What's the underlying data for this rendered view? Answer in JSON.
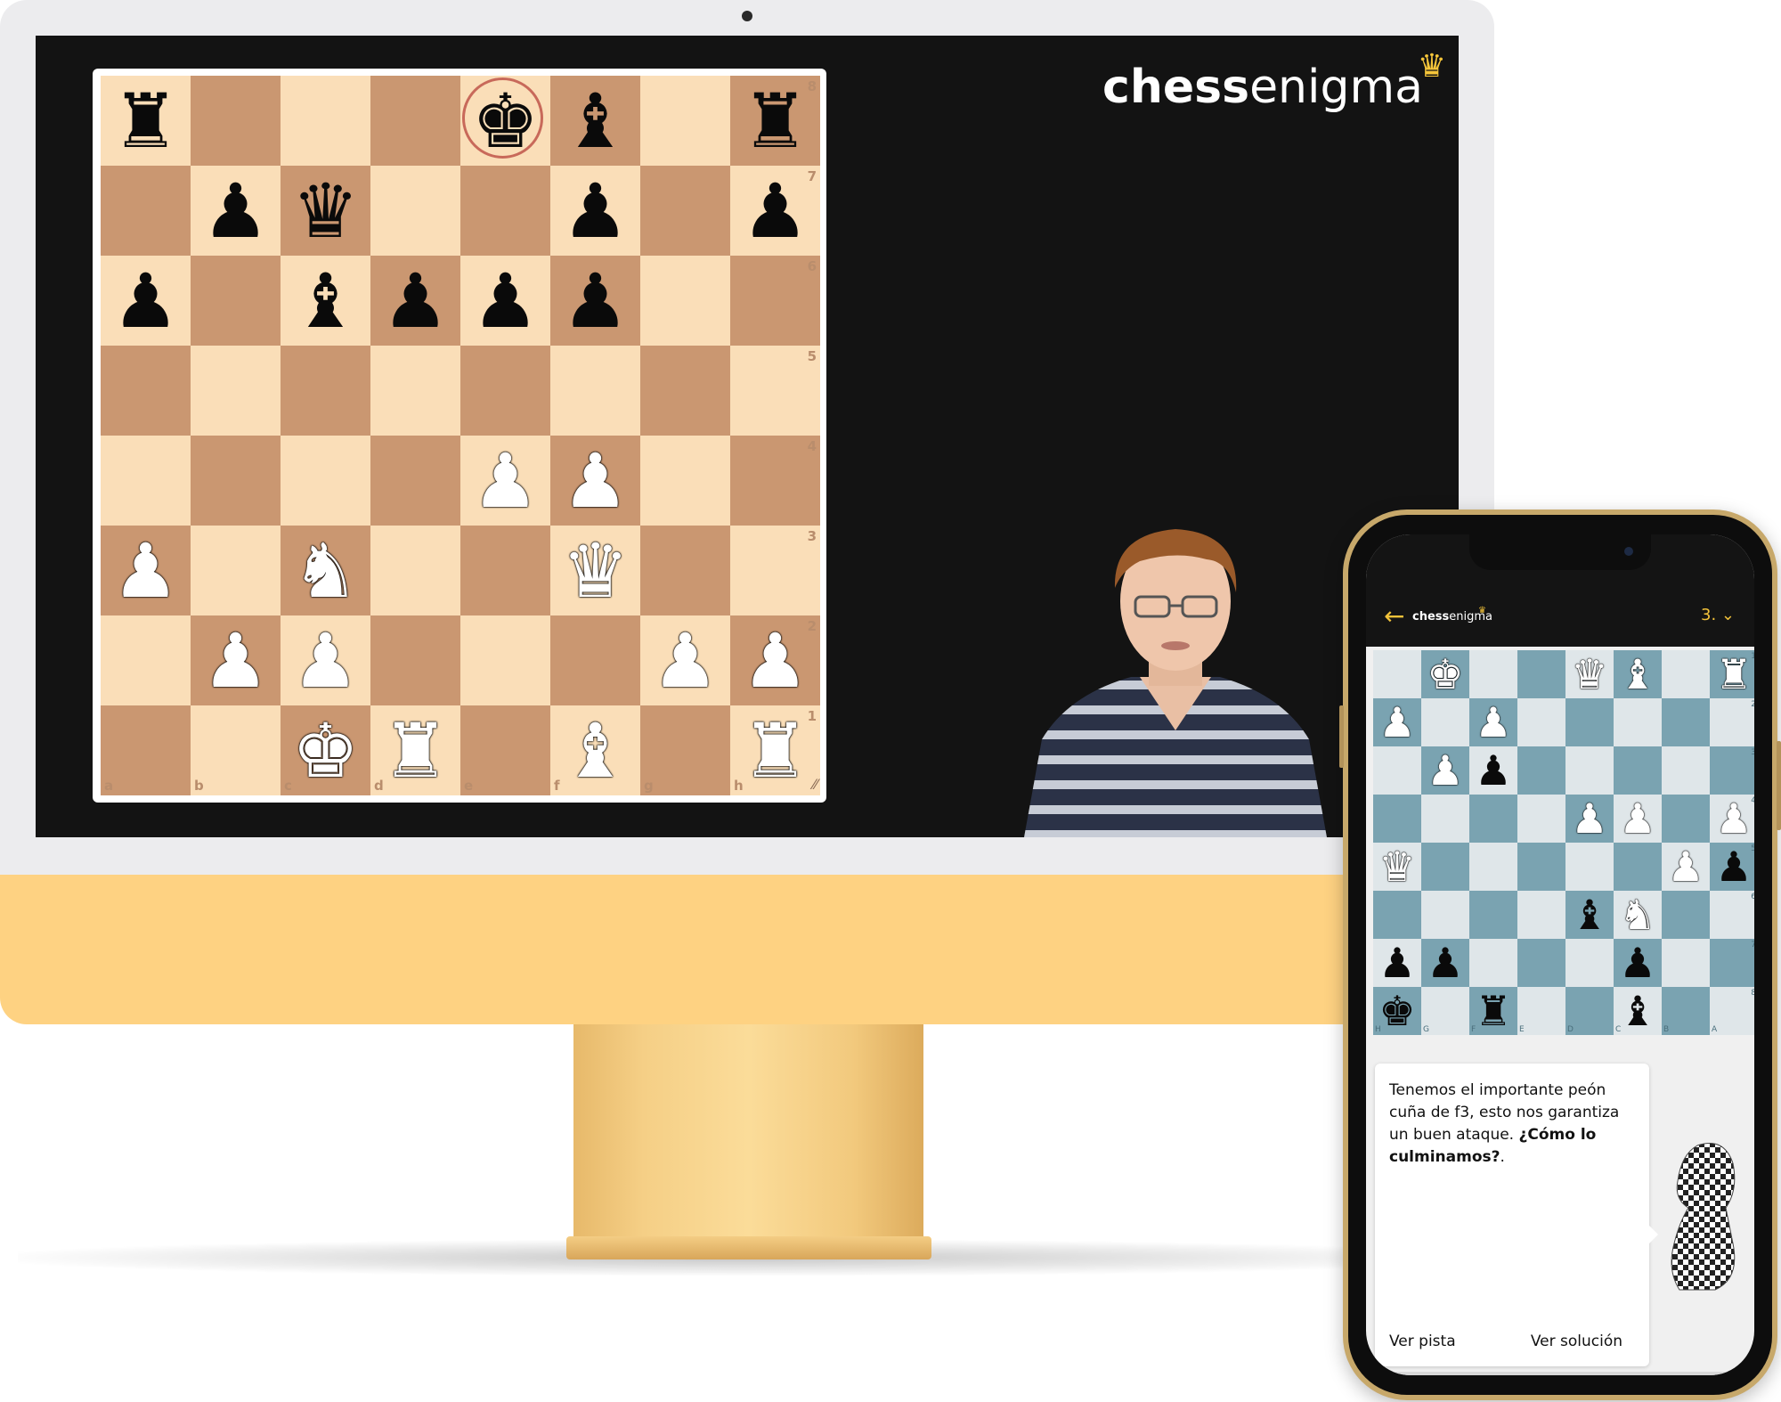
{
  "desktop": {
    "logo": {
      "regular": "chess",
      "bold_prefix": "",
      "text_a": "chess",
      "text_b": "enigma"
    },
    "board": {
      "rank_labels": [
        "8",
        "7",
        "6",
        "5",
        "4",
        "3",
        "2",
        "1"
      ],
      "file_labels": [
        "a",
        "b",
        "c",
        "d",
        "e",
        "f",
        "g",
        "h"
      ],
      "pieces": [
        [
          "bR",
          "",
          "",
          "",
          "bK",
          "bB",
          "",
          "bR"
        ],
        [
          "",
          "bP",
          "bQ",
          "",
          "",
          "bP",
          "",
          "bP"
        ],
        [
          "bP",
          "",
          "bB",
          "bP",
          "bP",
          "bP",
          "",
          ""
        ],
        [
          "",
          "",
          "",
          "",
          "",
          "",
          "",
          ""
        ],
        [
          "",
          "",
          "",
          "",
          "wP",
          "wP",
          "",
          ""
        ],
        [
          "wP",
          "",
          "wN",
          "",
          "",
          "wQ",
          "",
          ""
        ],
        [
          "",
          "wP",
          "wP",
          "",
          "",
          "",
          "wP",
          "wP"
        ],
        [
          "",
          "",
          "wK",
          "wR",
          "",
          "wB",
          "",
          "wR"
        ]
      ],
      "highlight": "e8"
    }
  },
  "phone": {
    "logo": {
      "text_a": "chess",
      "text_b": "enigma"
    },
    "back_icon": "arrow-left-icon",
    "step_label": "3. ⌄",
    "board": {
      "rank_labels": [
        "1",
        "2",
        "3",
        "4",
        "5",
        "6",
        "7",
        "8"
      ],
      "file_labels": [
        "H",
        "G",
        "F",
        "E",
        "D",
        "C",
        "B",
        "A"
      ],
      "pieces": [
        [
          "",
          "wK",
          "",
          "",
          "wQ",
          "wB",
          "",
          "wR"
        ],
        [
          "wP",
          "",
          "wP",
          "",
          "",
          "",
          "",
          ""
        ],
        [
          "",
          "wP",
          "bP",
          "",
          "",
          "",
          "",
          ""
        ],
        [
          "",
          "",
          "",
          "",
          "wP",
          "wP",
          "",
          "wP"
        ],
        [
          "wQ",
          "",
          "",
          "",
          "",
          "",
          "wP",
          "bP"
        ],
        [
          "",
          "",
          "",
          "",
          "bB",
          "wN",
          "",
          ""
        ],
        [
          "bP",
          "bP",
          "",
          "",
          "",
          "bP",
          "",
          ""
        ],
        [
          "bK",
          "",
          "bR",
          "",
          "",
          "bB",
          "",
          ""
        ]
      ]
    },
    "card": {
      "text_regular": "Tenemos el importante peón cuña de f3, esto nos garantiza un buen ataque. ",
      "text_bold": "¿Cómo lo culminamos?",
      "text_end": ".",
      "hint_label": "Ver pista",
      "solution_label": "Ver solución"
    }
  },
  "colors": {
    "accent_yellow": "#f2c23a",
    "board_light": "#fadeb8",
    "board_dark": "#ca9771",
    "phone_board_light": "#dfe6e9",
    "phone_board_dark": "#7aa3b1"
  }
}
